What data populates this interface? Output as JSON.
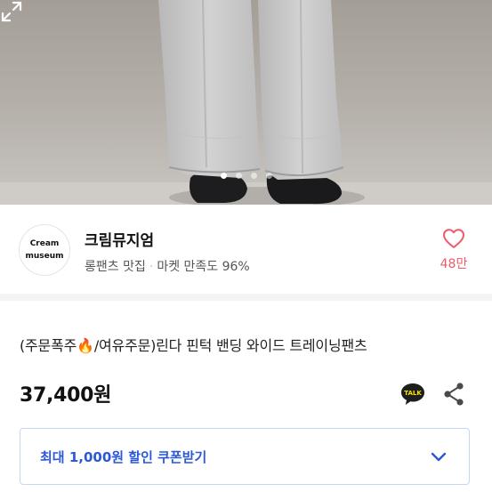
{
  "product_photo": {
    "slide_count": 4,
    "active_slide": 1,
    "icons": {
      "expand": "expand-icon"
    }
  },
  "seller": {
    "avatar_lines": [
      "Cream",
      "museum"
    ],
    "name": "크림뮤지엄",
    "tagline": "롱팬츠 맛집",
    "separator": "·",
    "rating": "마켓 만족도 96%",
    "likes": "48만",
    "icons": {
      "like": "heart-icon"
    }
  },
  "product": {
    "title": "(주문폭주🔥/여유주문)린다 핀턱 밴딩 와이드 트레이닝팬츠",
    "price": "37,400원",
    "icons": {
      "talk": "kakaotalk-icon",
      "share": "share-icon"
    },
    "talk_badge": "TALK"
  },
  "coupon": {
    "label": "최대 1,000원 할인 쿠폰받기",
    "icon": "chevron-down-icon"
  },
  "colors": {
    "like": "#ef5a6a",
    "coupon_text": "#2b58d6",
    "coupon_border": "#c8d6f5"
  }
}
